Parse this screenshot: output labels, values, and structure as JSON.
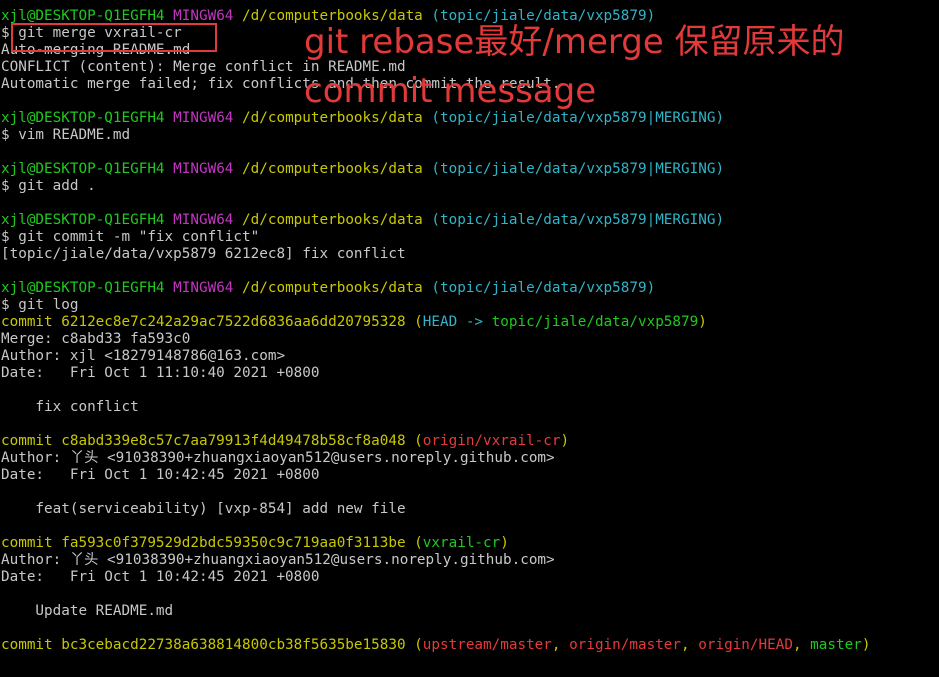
{
  "terminal": {
    "lines": [
      [
        {
          "c": "user",
          "t": "xjl@DESKTOP-Q1EGFH4"
        },
        {
          "c": "text",
          "t": " "
        },
        {
          "c": "mingw",
          "t": "MINGW64"
        },
        {
          "c": "text",
          "t": " "
        },
        {
          "c": "path",
          "t": "/d/computerbooks/data"
        },
        {
          "c": "text",
          "t": " "
        },
        {
          "c": "branch",
          "t": "(topic/jiale/data/vxp5879)"
        }
      ],
      [
        {
          "c": "text",
          "t": "$ git merge vxrail-cr"
        }
      ],
      [
        {
          "c": "text",
          "t": "Auto-merging README.md"
        }
      ],
      [
        {
          "c": "text",
          "t": "CONFLICT (content): Merge conflict in README.md"
        }
      ],
      [
        {
          "c": "text",
          "t": "Automatic merge failed; fix conflicts and then commit the result."
        }
      ],
      [],
      [
        {
          "c": "user",
          "t": "xjl@DESKTOP-Q1EGFH4"
        },
        {
          "c": "text",
          "t": " "
        },
        {
          "c": "mingw",
          "t": "MINGW64"
        },
        {
          "c": "text",
          "t": " "
        },
        {
          "c": "path",
          "t": "/d/computerbooks/data"
        },
        {
          "c": "text",
          "t": " "
        },
        {
          "c": "branch",
          "t": "(topic/jiale/data/vxp5879|MERGING)"
        }
      ],
      [
        {
          "c": "text",
          "t": "$ vim README.md"
        }
      ],
      [],
      [
        {
          "c": "user",
          "t": "xjl@DESKTOP-Q1EGFH4"
        },
        {
          "c": "text",
          "t": " "
        },
        {
          "c": "mingw",
          "t": "MINGW64"
        },
        {
          "c": "text",
          "t": " "
        },
        {
          "c": "path",
          "t": "/d/computerbooks/data"
        },
        {
          "c": "text",
          "t": " "
        },
        {
          "c": "branch",
          "t": "(topic/jiale/data/vxp5879|MERGING)"
        }
      ],
      [
        {
          "c": "text",
          "t": "$ git add ."
        }
      ],
      [],
      [
        {
          "c": "user",
          "t": "xjl@DESKTOP-Q1EGFH4"
        },
        {
          "c": "text",
          "t": " "
        },
        {
          "c": "mingw",
          "t": "MINGW64"
        },
        {
          "c": "text",
          "t": " "
        },
        {
          "c": "path",
          "t": "/d/computerbooks/data"
        },
        {
          "c": "text",
          "t": " "
        },
        {
          "c": "branch",
          "t": "(topic/jiale/data/vxp5879|MERGING)"
        }
      ],
      [
        {
          "c": "text",
          "t": "$ git commit -m \"fix conflict\""
        }
      ],
      [
        {
          "c": "text",
          "t": "[topic/jiale/data/vxp5879 6212ec8] fix conflict"
        }
      ],
      [],
      [
        {
          "c": "user",
          "t": "xjl@DESKTOP-Q1EGFH4"
        },
        {
          "c": "text",
          "t": " "
        },
        {
          "c": "mingw",
          "t": "MINGW64"
        },
        {
          "c": "text",
          "t": " "
        },
        {
          "c": "path",
          "t": "/d/computerbooks/data"
        },
        {
          "c": "text",
          "t": " "
        },
        {
          "c": "branch",
          "t": "(topic/jiale/data/vxp5879)"
        }
      ],
      [
        {
          "c": "text",
          "t": "$ git log"
        }
      ],
      [
        {
          "c": "hash",
          "t": "commit 6212ec8e7c242a29ac7522d6836aa6dd20795328 "
        },
        {
          "c": "hash",
          "t": "("
        },
        {
          "c": "head",
          "t": "HEAD -> "
        },
        {
          "c": "local",
          "t": "topic/jiale/data/vxp5879"
        },
        {
          "c": "hash",
          "t": ")"
        }
      ],
      [
        {
          "c": "text",
          "t": "Merge: c8abd33 fa593c0"
        }
      ],
      [
        {
          "c": "text",
          "t": "Author: xjl <18279148786@163.com>"
        }
      ],
      [
        {
          "c": "text",
          "t": "Date:   Fri Oct 1 11:10:40 2021 +0800"
        }
      ],
      [],
      [
        {
          "c": "text",
          "t": "    fix conflict"
        }
      ],
      [],
      [
        {
          "c": "hash",
          "t": "commit c8abd339e8c57c7aa79913f4d49478b58cf8a048 "
        },
        {
          "c": "hash",
          "t": "("
        },
        {
          "c": "remote",
          "t": "origin/vxrail-cr"
        },
        {
          "c": "hash",
          "t": ")"
        }
      ],
      [
        {
          "c": "text",
          "t": "Author: 丫头 <91038390+zhuangxiaoyan512@users.noreply.github.com>"
        }
      ],
      [
        {
          "c": "text",
          "t": "Date:   Fri Oct 1 10:42:45 2021 +0800"
        }
      ],
      [],
      [
        {
          "c": "text",
          "t": "    feat(serviceability) [vxp-854] add new file"
        }
      ],
      [],
      [
        {
          "c": "hash",
          "t": "commit fa593c0f379529d2bdc59350c9c719aa0f3113be "
        },
        {
          "c": "hash",
          "t": "("
        },
        {
          "c": "local",
          "t": "vxrail-cr"
        },
        {
          "c": "hash",
          "t": ")"
        }
      ],
      [
        {
          "c": "text",
          "t": "Author: 丫头 <91038390+zhuangxiaoyan512@users.noreply.github.com>"
        }
      ],
      [
        {
          "c": "text",
          "t": "Date:   Fri Oct 1 10:42:45 2021 +0800"
        }
      ],
      [],
      [
        {
          "c": "text",
          "t": "    Update README.md"
        }
      ],
      [],
      [
        {
          "c": "hash",
          "t": "commit bc3cebacd22738a638814800cb38f5635be15830 "
        },
        {
          "c": "hash",
          "t": "("
        },
        {
          "c": "remote",
          "t": "upstream/master"
        },
        {
          "c": "hash",
          "t": ", "
        },
        {
          "c": "remote",
          "t": "origin/master"
        },
        {
          "c": "hash",
          "t": ", "
        },
        {
          "c": "remote",
          "t": "origin/HEAD"
        },
        {
          "c": "hash",
          "t": ", "
        },
        {
          "c": "local",
          "t": "master"
        },
        {
          "c": "hash",
          "t": ")"
        }
      ]
    ]
  },
  "annotation": {
    "text": "git rebase最好/merge 保留原来的commit message"
  },
  "colors": {
    "background": "#000000",
    "text": "#c8c8c8",
    "user": "#1fc91f",
    "mingw": "#c136c1",
    "path": "#c8c800",
    "branch": "#2fb4c8",
    "remote": "#e33b3b",
    "annotation": "#e23a3a"
  }
}
